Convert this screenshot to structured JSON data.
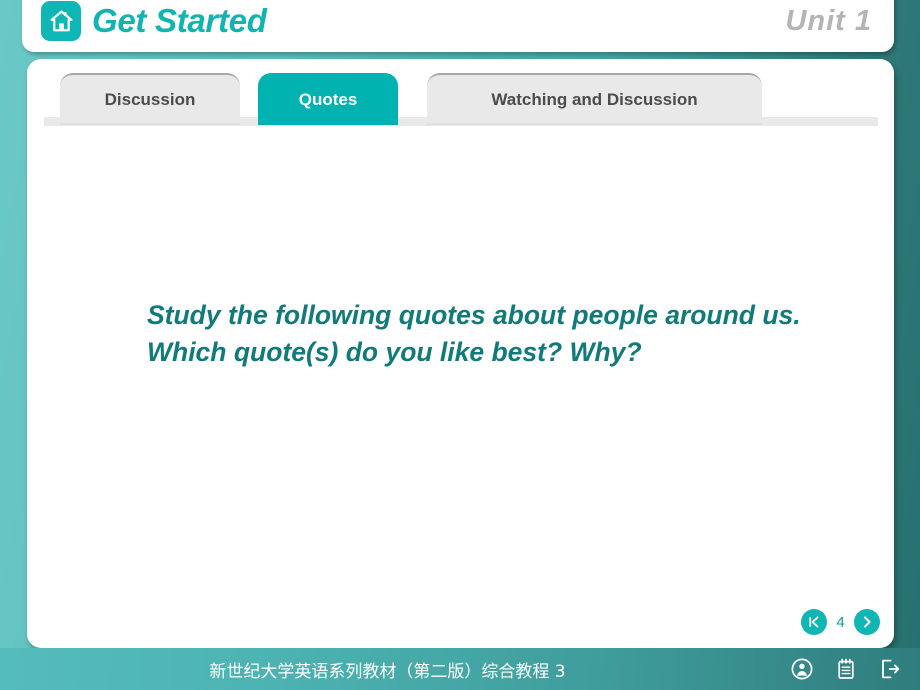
{
  "header": {
    "home_icon": "home-icon",
    "title": "Get Started",
    "unit_label": "Unit  1"
  },
  "tabs": [
    {
      "label": "Discussion",
      "active": false
    },
    {
      "label": "Quotes",
      "active": true
    },
    {
      "label": "Watching and Discussion",
      "active": false
    }
  ],
  "main": {
    "body_text": "Study the following quotes about people around us. Which quote(s) do you like best? Why?"
  },
  "pager": {
    "first_icon": "first-page-icon",
    "page_number": "4",
    "next_icon": "chevron-right-icon"
  },
  "footer": {
    "title": "新世纪大学英语系列教材（第二版）综合教程 3",
    "icons": [
      {
        "name": "user-profile-icon"
      },
      {
        "name": "notepad-icon"
      },
      {
        "name": "exit-icon"
      }
    ]
  },
  "colors": {
    "accent_teal": "#00b3b0",
    "icon_teal": "#0eb6b6",
    "title_teal": "#12b4b2",
    "body_teal": "#117a7a",
    "tab_inactive_gray": "#e9e9e9",
    "unit_gray": "#b4b4b4",
    "background_teal_light": "#6ac9c7",
    "background_teal_dark": "#27706f"
  }
}
